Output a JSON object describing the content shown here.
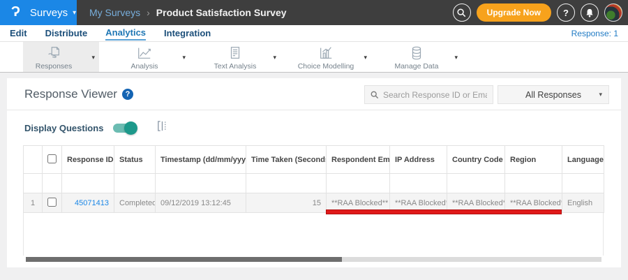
{
  "icons": {
    "logo_glyph": "Ɂ",
    "caret_down": "▾",
    "breadcrumb_sep": "›",
    "sort_desc": "▾",
    "sort_both": "⇅",
    "help_glyph": "?"
  },
  "topbar": {
    "product_label": "Surveys",
    "breadcrumb": {
      "parent": "My Surveys",
      "current": "Product Satisfaction Survey"
    },
    "upgrade_label": "Upgrade Now"
  },
  "nav": {
    "items": [
      {
        "label": "Edit",
        "active": false
      },
      {
        "label": "Distribute",
        "active": false
      },
      {
        "label": "Analytics",
        "active": true
      },
      {
        "label": "Integration",
        "active": false
      }
    ],
    "response_count": "Response: 1"
  },
  "toolbar": {
    "items": [
      {
        "label": "Responses",
        "icon": "responses-icon",
        "selected": true
      },
      {
        "label": "Analysis",
        "icon": "analysis-icon",
        "selected": false
      },
      {
        "label": "Text Analysis",
        "icon": "text-analysis-icon",
        "selected": false
      },
      {
        "label": "Choice Modelling",
        "icon": "choice-modelling-icon",
        "selected": false
      },
      {
        "label": "Manage Data",
        "icon": "manage-data-icon",
        "selected": false
      }
    ]
  },
  "viewer": {
    "title": "Response Viewer",
    "search_placeholder": "Search Response ID or Email",
    "filter_value": "All Responses",
    "display_questions_label": "Display Questions",
    "toggle_state": "on"
  },
  "table": {
    "columns": [
      {
        "label": "Response ID",
        "sort": "desc"
      },
      {
        "label": "Status",
        "sort": ""
      },
      {
        "label": "Timestamp (dd/mm/yyyy)",
        "sort": "both"
      },
      {
        "label": "Time Taken (Seconds)",
        "sort": "both"
      },
      {
        "label": "Respondent Email",
        "sort": ""
      },
      {
        "label": "IP Address",
        "sort": ""
      },
      {
        "label": "Country Code",
        "sort": ""
      },
      {
        "label": "Region",
        "sort": ""
      },
      {
        "label": "Language",
        "sort": ""
      }
    ],
    "row": {
      "num": "1",
      "response_id": "45071413",
      "status": "Completed",
      "timestamp": "09/12/2019 13:12:45",
      "time_taken": "15",
      "respondent_email": "**RAA Blocked**",
      "ip_address": "**RAA Blocked**",
      "country_code": "**RAA Blocked**",
      "region": "**RAA Blocked**",
      "language": "English"
    }
  },
  "colors": {
    "brand_blue": "#1b87e6",
    "upgrade_orange": "#f7a21c",
    "toggle_teal": "#1d998b",
    "annotation_red": "#e01a1a",
    "topbar_dark": "#3e3e3e"
  }
}
